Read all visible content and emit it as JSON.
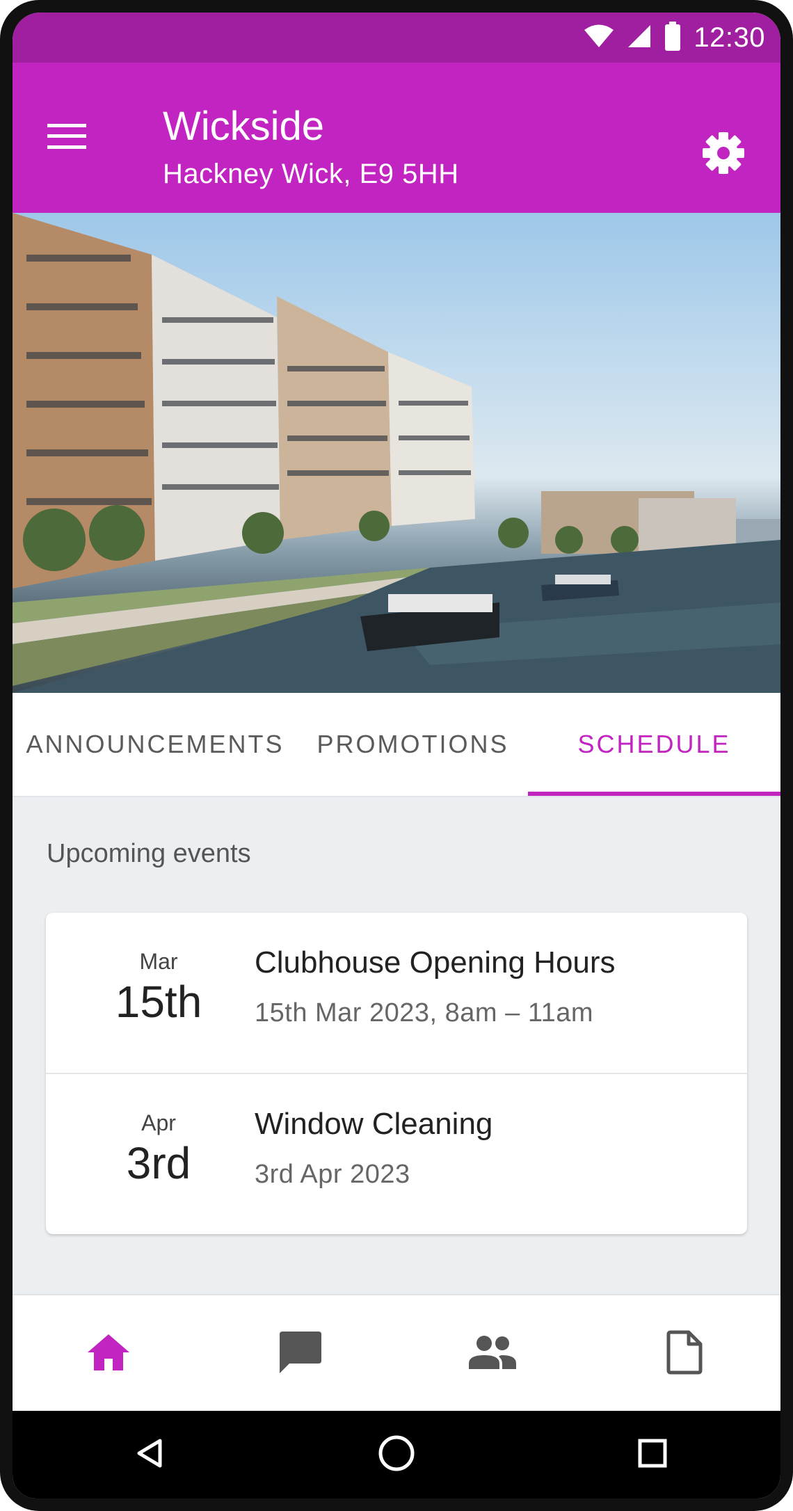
{
  "status_bar": {
    "time": "12:30"
  },
  "app_bar": {
    "title": "Wickside",
    "subtitle": "Hackney Wick, E9 5HH"
  },
  "tabs": [
    {
      "label": "ANNOUNCEMENTS",
      "active": false
    },
    {
      "label": "PROMOTIONS",
      "active": false
    },
    {
      "label": "SCHEDULE",
      "active": true
    }
  ],
  "schedule": {
    "section_title": "Upcoming events",
    "events": [
      {
        "month": "Mar",
        "day": "15th",
        "title": "Clubhouse Opening Hours",
        "detail": "15th Mar 2023, 8am – 11am"
      },
      {
        "month": "Apr",
        "day": "3rd",
        "title": "Window Cleaning",
        "detail": "3rd Apr 2023"
      }
    ]
  },
  "bottom_nav": [
    {
      "icon": "home-icon",
      "active": true
    },
    {
      "icon": "chat-icon",
      "active": false
    },
    {
      "icon": "people-icon",
      "active": false
    },
    {
      "icon": "document-icon",
      "active": false
    }
  ],
  "colors": {
    "accent": "#c124c0",
    "status_bar": "#a01fa0",
    "background": "#eceff2",
    "inactive_icon": "#555555"
  }
}
